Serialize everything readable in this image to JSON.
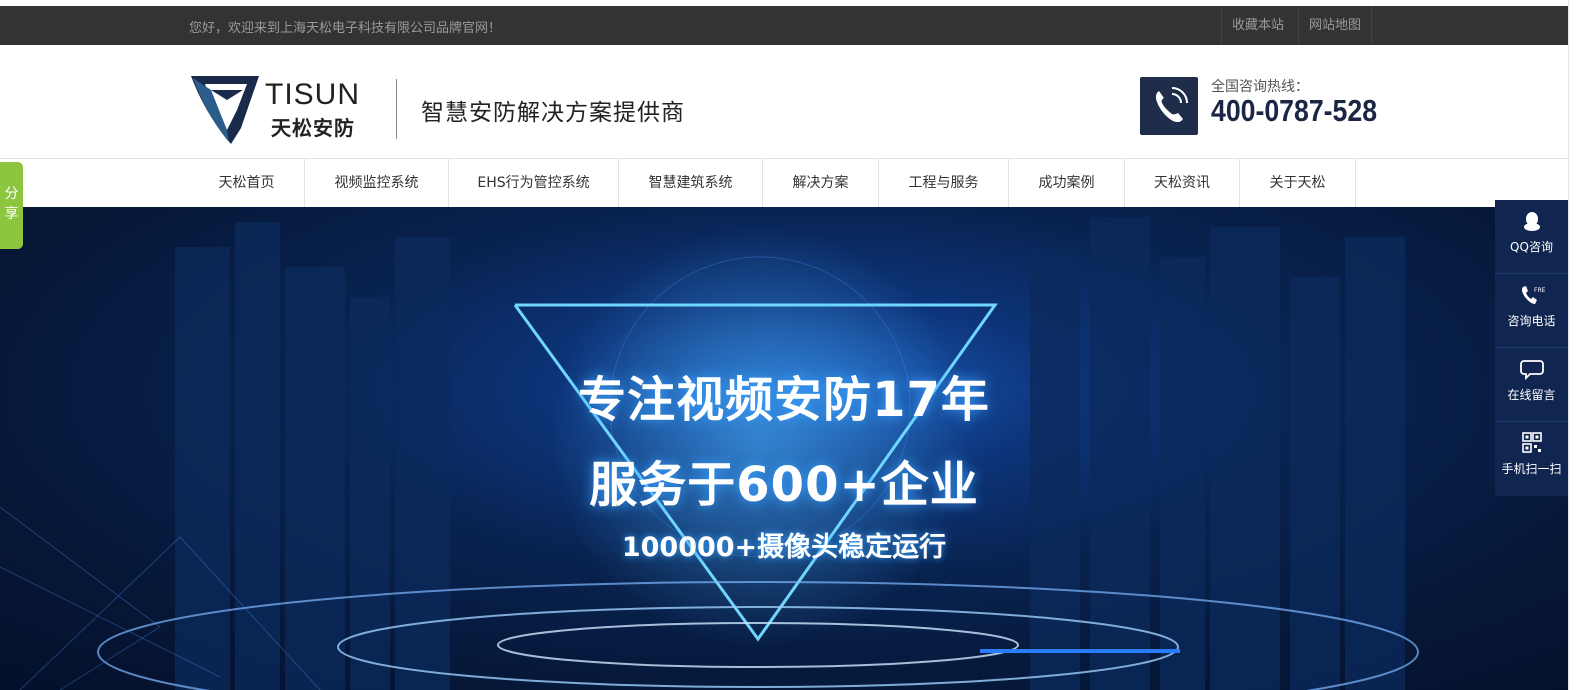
{
  "topbar": {
    "welcome": "您好，欢迎来到上海天松电子科技有限公司品牌官网！",
    "links": [
      "收藏本站",
      "网站地图"
    ]
  },
  "header": {
    "logo_text": "TISUN",
    "logo_sub": "天松安防",
    "slogan": "智慧安防解决方案提供商",
    "hotline_label": "全国咨询热线：",
    "hotline_number": "400-0787-528"
  },
  "nav": {
    "items": [
      "天松首页",
      "视频监控系统",
      "EHS行为管控系统",
      "智慧建筑系统",
      "解决方案",
      "工程与服务",
      "成功案例",
      "天松资讯",
      "关于天松"
    ]
  },
  "banner": {
    "line1": "专注视频安防17年",
    "line2": "服务于600+企业",
    "line3": "100000+摄像头稳定运行"
  },
  "share": {
    "label": "分享"
  },
  "float": {
    "items": [
      {
        "icon": "qq-icon",
        "label": "QQ咨询"
      },
      {
        "icon": "phone-free-icon",
        "label": "咨询电话"
      },
      {
        "icon": "chat-bubble-icon",
        "label": "在线留言"
      },
      {
        "icon": "qr-code-icon",
        "label": "手机扫一扫"
      }
    ]
  },
  "colors": {
    "topbar_bg": "#333333",
    "brand_navy": "#1f2c4a",
    "share_green": "#8cc63f",
    "float_bg": "#10254f"
  }
}
